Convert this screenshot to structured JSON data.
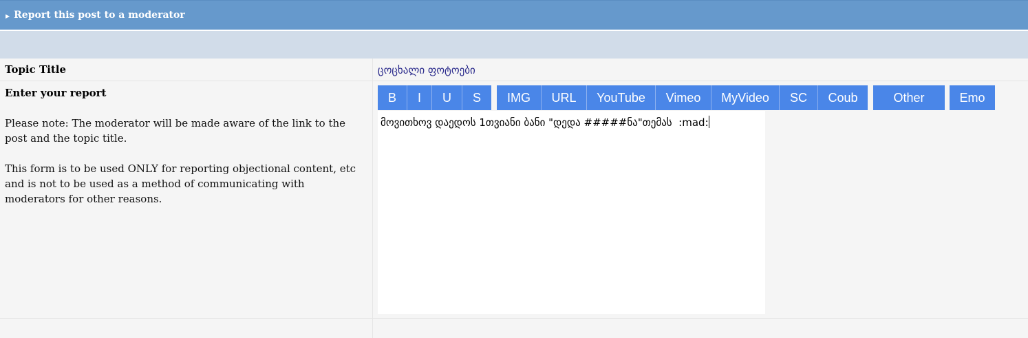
{
  "header": {
    "title": "Report this post to a moderator",
    "arrow_icon": "triangle-right-icon"
  },
  "topic": {
    "label": "Topic Title",
    "value": "ცოცხალი ფოტოები"
  },
  "report": {
    "label": "Enter your report",
    "note1": "Please note: The moderator will be made aware of the link to the post and the topic title.",
    "note2": "This form is to be used ONLY for reporting objectional content, etc and is not to be used as a method of communicating with moderators for other reasons.",
    "text": "მოვითხოვ დაედოს 1თვიანი ბანი \"დედა #####ნა\"თემას  :mad:"
  },
  "toolbar": {
    "bold": "B",
    "italic": "I",
    "underline": "U",
    "strike": "S",
    "img": "IMG",
    "url": "URL",
    "youtube": "YouTube",
    "vimeo": "Vimeo",
    "myvideo": "MyVideo",
    "sc": "SC",
    "coub": "Coub",
    "other": "Other",
    "emo": "Emo"
  },
  "colors": {
    "header_bg": "#6699cc",
    "subbar_bg": "#d1dce9",
    "button_bg": "#4a86e8",
    "topic_value": "#2b2b8c"
  }
}
